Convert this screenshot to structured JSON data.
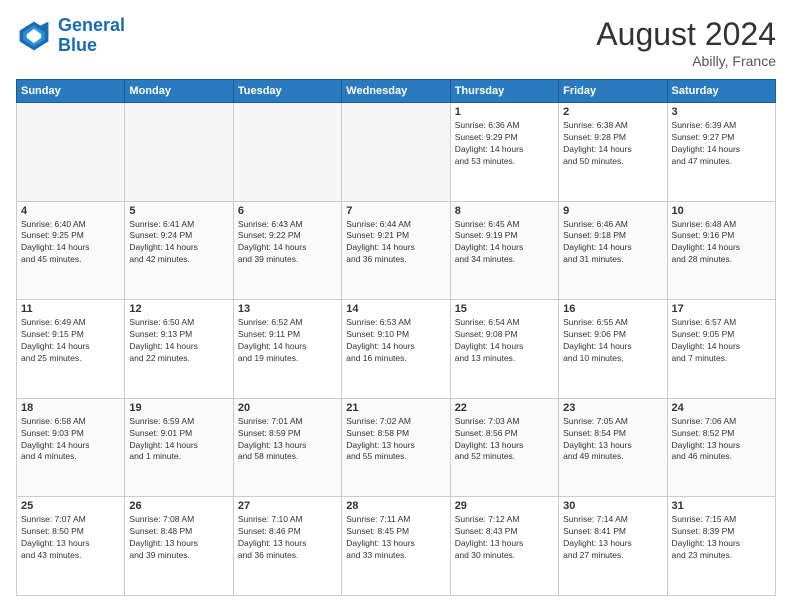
{
  "header": {
    "logo_line1": "General",
    "logo_line2": "Blue",
    "month_title": "August 2024",
    "location": "Abilly, France"
  },
  "weekdays": [
    "Sunday",
    "Monday",
    "Tuesday",
    "Wednesday",
    "Thursday",
    "Friday",
    "Saturday"
  ],
  "weeks": [
    [
      {
        "day": "",
        "info": ""
      },
      {
        "day": "",
        "info": ""
      },
      {
        "day": "",
        "info": ""
      },
      {
        "day": "",
        "info": ""
      },
      {
        "day": "1",
        "info": "Sunrise: 6:36 AM\nSunset: 9:29 PM\nDaylight: 14 hours\nand 53 minutes."
      },
      {
        "day": "2",
        "info": "Sunrise: 6:38 AM\nSunset: 9:28 PM\nDaylight: 14 hours\nand 50 minutes."
      },
      {
        "day": "3",
        "info": "Sunrise: 6:39 AM\nSunset: 9:27 PM\nDaylight: 14 hours\nand 47 minutes."
      }
    ],
    [
      {
        "day": "4",
        "info": "Sunrise: 6:40 AM\nSunset: 9:25 PM\nDaylight: 14 hours\nand 45 minutes."
      },
      {
        "day": "5",
        "info": "Sunrise: 6:41 AM\nSunset: 9:24 PM\nDaylight: 14 hours\nand 42 minutes."
      },
      {
        "day": "6",
        "info": "Sunrise: 6:43 AM\nSunset: 9:22 PM\nDaylight: 14 hours\nand 39 minutes."
      },
      {
        "day": "7",
        "info": "Sunrise: 6:44 AM\nSunset: 9:21 PM\nDaylight: 14 hours\nand 36 minutes."
      },
      {
        "day": "8",
        "info": "Sunrise: 6:45 AM\nSunset: 9:19 PM\nDaylight: 14 hours\nand 34 minutes."
      },
      {
        "day": "9",
        "info": "Sunrise: 6:46 AM\nSunset: 9:18 PM\nDaylight: 14 hours\nand 31 minutes."
      },
      {
        "day": "10",
        "info": "Sunrise: 6:48 AM\nSunset: 9:16 PM\nDaylight: 14 hours\nand 28 minutes."
      }
    ],
    [
      {
        "day": "11",
        "info": "Sunrise: 6:49 AM\nSunset: 9:15 PM\nDaylight: 14 hours\nand 25 minutes."
      },
      {
        "day": "12",
        "info": "Sunrise: 6:50 AM\nSunset: 9:13 PM\nDaylight: 14 hours\nand 22 minutes."
      },
      {
        "day": "13",
        "info": "Sunrise: 6:52 AM\nSunset: 9:11 PM\nDaylight: 14 hours\nand 19 minutes."
      },
      {
        "day": "14",
        "info": "Sunrise: 6:53 AM\nSunset: 9:10 PM\nDaylight: 14 hours\nand 16 minutes."
      },
      {
        "day": "15",
        "info": "Sunrise: 6:54 AM\nSunset: 9:08 PM\nDaylight: 14 hours\nand 13 minutes."
      },
      {
        "day": "16",
        "info": "Sunrise: 6:55 AM\nSunset: 9:06 PM\nDaylight: 14 hours\nand 10 minutes."
      },
      {
        "day": "17",
        "info": "Sunrise: 6:57 AM\nSunset: 9:05 PM\nDaylight: 14 hours\nand 7 minutes."
      }
    ],
    [
      {
        "day": "18",
        "info": "Sunrise: 6:58 AM\nSunset: 9:03 PM\nDaylight: 14 hours\nand 4 minutes."
      },
      {
        "day": "19",
        "info": "Sunrise: 6:59 AM\nSunset: 9:01 PM\nDaylight: 14 hours\nand 1 minute."
      },
      {
        "day": "20",
        "info": "Sunrise: 7:01 AM\nSunset: 8:59 PM\nDaylight: 13 hours\nand 58 minutes."
      },
      {
        "day": "21",
        "info": "Sunrise: 7:02 AM\nSunset: 8:58 PM\nDaylight: 13 hours\nand 55 minutes."
      },
      {
        "day": "22",
        "info": "Sunrise: 7:03 AM\nSunset: 8:56 PM\nDaylight: 13 hours\nand 52 minutes."
      },
      {
        "day": "23",
        "info": "Sunrise: 7:05 AM\nSunset: 8:54 PM\nDaylight: 13 hours\nand 49 minutes."
      },
      {
        "day": "24",
        "info": "Sunrise: 7:06 AM\nSunset: 8:52 PM\nDaylight: 13 hours\nand 46 minutes."
      }
    ],
    [
      {
        "day": "25",
        "info": "Sunrise: 7:07 AM\nSunset: 8:50 PM\nDaylight: 13 hours\nand 43 minutes."
      },
      {
        "day": "26",
        "info": "Sunrise: 7:08 AM\nSunset: 8:48 PM\nDaylight: 13 hours\nand 39 minutes."
      },
      {
        "day": "27",
        "info": "Sunrise: 7:10 AM\nSunset: 8:46 PM\nDaylight: 13 hours\nand 36 minutes."
      },
      {
        "day": "28",
        "info": "Sunrise: 7:11 AM\nSunset: 8:45 PM\nDaylight: 13 hours\nand 33 minutes."
      },
      {
        "day": "29",
        "info": "Sunrise: 7:12 AM\nSunset: 8:43 PM\nDaylight: 13 hours\nand 30 minutes."
      },
      {
        "day": "30",
        "info": "Sunrise: 7:14 AM\nSunset: 8:41 PM\nDaylight: 13 hours\nand 27 minutes."
      },
      {
        "day": "31",
        "info": "Sunrise: 7:15 AM\nSunset: 8:39 PM\nDaylight: 13 hours\nand 23 minutes."
      }
    ]
  ]
}
